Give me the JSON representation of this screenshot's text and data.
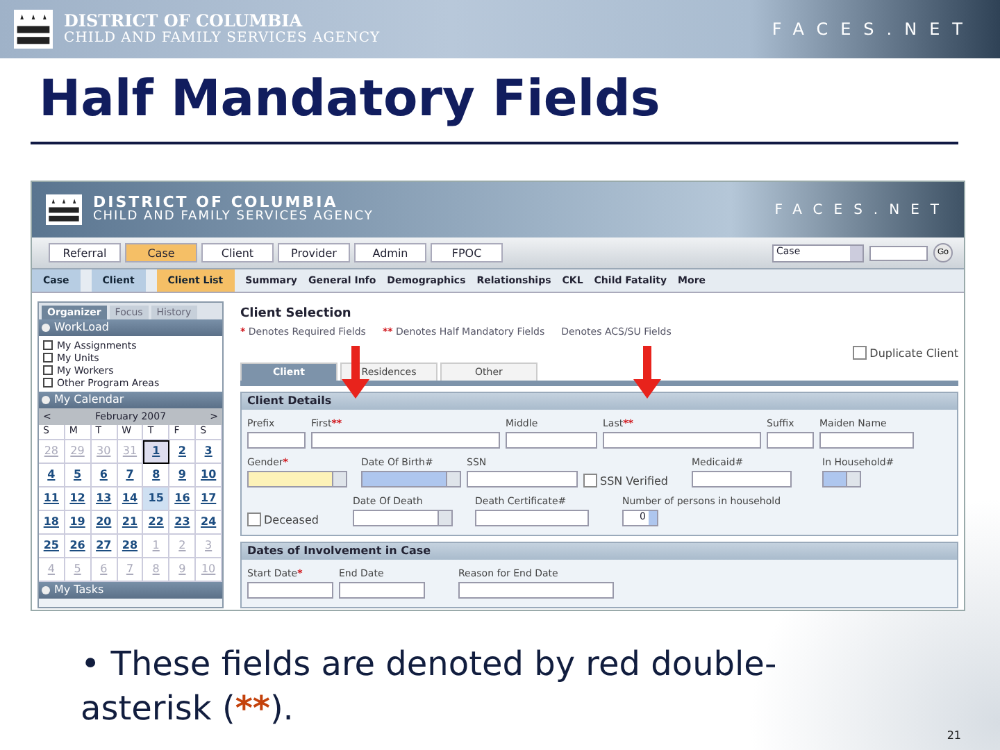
{
  "slide_header": {
    "agency_line_1": "DISTRICT OF COLUMBIA",
    "agency_line_2": "CHILD AND FAMILY SERVICES AGENCY",
    "brand": "FACES.NET"
  },
  "title": "Half Mandatory Fields",
  "screenshot": {
    "header": {
      "agency_line_1": "DISTRICT OF COLUMBIA",
      "agency_line_2": "CHILD AND FAMILY SERVICES AGENCY",
      "brand": "FACES.NET"
    },
    "nav_tabs": [
      {
        "label": "Referral",
        "selected": false
      },
      {
        "label": "Case",
        "selected": true
      },
      {
        "label": "Client",
        "selected": false
      },
      {
        "label": "Provider",
        "selected": false
      },
      {
        "label": "Admin",
        "selected": false
      },
      {
        "label": "FPOC",
        "selected": false
      }
    ],
    "search": {
      "select_value": "Case",
      "button": "Go"
    },
    "breadcrumb": [
      {
        "label": "Case",
        "selected": false
      },
      {
        "label": "Client",
        "selected": false
      },
      {
        "label": "Client List",
        "selected": true
      }
    ],
    "sub_links": [
      "Summary",
      "General Info",
      "Demographics",
      "Relationships",
      "CKL",
      "Child Fatality",
      "More"
    ],
    "sidebar": {
      "tabs": [
        {
          "label": "Organizer",
          "selected": true
        },
        {
          "label": "Focus",
          "selected": false
        },
        {
          "label": "History",
          "selected": false
        }
      ],
      "workload": {
        "title": "WorkLoad",
        "items": [
          "My Assignments",
          "My Units",
          "My Workers",
          "Other Program Areas"
        ]
      },
      "calendar": {
        "title": "My Calendar",
        "prev": "<",
        "month": "February 2007",
        "next": ">",
        "weekdays": [
          "S",
          "M",
          "T",
          "W",
          "T",
          "F",
          "S"
        ],
        "days": [
          {
            "label": "28",
            "other_month": true,
            "selected": false,
            "today": false
          },
          {
            "label": "29",
            "other_month": true,
            "selected": false,
            "today": false
          },
          {
            "label": "30",
            "other_month": true,
            "selected": false,
            "today": false
          },
          {
            "label": "31",
            "other_month": true,
            "selected": false,
            "today": false
          },
          {
            "label": "1",
            "other_month": false,
            "selected": true,
            "today": false
          },
          {
            "label": "2",
            "other_month": false,
            "selected": false,
            "today": false
          },
          {
            "label": "3",
            "other_month": false,
            "selected": false,
            "today": false
          },
          {
            "label": "4",
            "other_month": false,
            "selected": false,
            "today": false
          },
          {
            "label": "5",
            "other_month": false,
            "selected": false,
            "today": false
          },
          {
            "label": "6",
            "other_month": false,
            "selected": false,
            "today": false
          },
          {
            "label": "7",
            "other_month": false,
            "selected": false,
            "today": false
          },
          {
            "label": "8",
            "other_month": false,
            "selected": false,
            "today": false
          },
          {
            "label": "9",
            "other_month": false,
            "selected": false,
            "today": false
          },
          {
            "label": "10",
            "other_month": false,
            "selected": false,
            "today": false
          },
          {
            "label": "11",
            "other_month": false,
            "selected": false,
            "today": false
          },
          {
            "label": "12",
            "other_month": false,
            "selected": false,
            "today": false
          },
          {
            "label": "13",
            "other_month": false,
            "selected": false,
            "today": false
          },
          {
            "label": "14",
            "other_month": false,
            "selected": false,
            "today": false
          },
          {
            "label": "15",
            "other_month": false,
            "selected": false,
            "today": true
          },
          {
            "label": "16",
            "other_month": false,
            "selected": false,
            "today": false
          },
          {
            "label": "17",
            "other_month": false,
            "selected": false,
            "today": false
          },
          {
            "label": "18",
            "other_month": false,
            "selected": false,
            "today": false
          },
          {
            "label": "19",
            "other_month": false,
            "selected": false,
            "today": false
          },
          {
            "label": "20",
            "other_month": false,
            "selected": false,
            "today": false
          },
          {
            "label": "21",
            "other_month": false,
            "selected": false,
            "today": false
          },
          {
            "label": "22",
            "other_month": false,
            "selected": false,
            "today": false
          },
          {
            "label": "23",
            "other_month": false,
            "selected": false,
            "today": false
          },
          {
            "label": "24",
            "other_month": false,
            "selected": false,
            "today": false
          },
          {
            "label": "25",
            "other_month": false,
            "selected": false,
            "today": false
          },
          {
            "label": "26",
            "other_month": false,
            "selected": false,
            "today": false
          },
          {
            "label": "27",
            "other_month": false,
            "selected": false,
            "today": false
          },
          {
            "label": "28",
            "other_month": false,
            "selected": false,
            "today": false
          },
          {
            "label": "1",
            "other_month": true,
            "selected": false,
            "today": false
          },
          {
            "label": "2",
            "other_month": true,
            "selected": false,
            "today": false
          },
          {
            "label": "3",
            "other_month": true,
            "selected": false,
            "today": false
          },
          {
            "label": "4",
            "other_month": true,
            "selected": false,
            "today": false
          },
          {
            "label": "5",
            "other_month": true,
            "selected": false,
            "today": false
          },
          {
            "label": "6",
            "other_month": true,
            "selected": false,
            "today": false
          },
          {
            "label": "7",
            "other_month": true,
            "selected": false,
            "today": false
          },
          {
            "label": "8",
            "other_month": true,
            "selected": false,
            "today": false
          },
          {
            "label": "9",
            "other_month": true,
            "selected": false,
            "today": false
          },
          {
            "label": "10",
            "other_month": true,
            "selected": false,
            "today": false
          }
        ]
      },
      "tasks": {
        "title": "My Tasks"
      }
    },
    "main": {
      "title": "Client Selection",
      "legend": [
        {
          "marker": "*",
          "text": "Denotes Required Fields"
        },
        {
          "marker": "**",
          "text": "Denotes Half Mandatory Fields"
        },
        {
          "text": "Denotes ACS/SU Fields"
        }
      ],
      "duplicate": {
        "label": "Duplicate Client",
        "checked": false
      },
      "tabs": [
        {
          "label": "Client",
          "selected": true
        },
        {
          "label": "Residences",
          "selected": false
        },
        {
          "label": "Other",
          "selected": false
        }
      ],
      "sections": [
        {
          "title": "Client Details",
          "rows": [
            [
              {
                "kind": "text",
                "label": "Prefix"
              },
              {
                "kind": "text",
                "label": "First",
                "marker": "**",
                "arrow": true
              },
              {
                "kind": "text",
                "label": "Middle"
              },
              {
                "kind": "text",
                "label": "Last",
                "marker": "**",
                "arrow": true
              },
              {
                "kind": "text",
                "label": "Suffix"
              },
              {
                "kind": "text",
                "label": "Maiden Name"
              }
            ],
            [
              {
                "kind": "select",
                "label": "Gender",
                "marker": "*",
                "color": "#fdf2b8"
              },
              {
                "kind": "select",
                "label": "Date Of Birth#",
                "color": "#aec6ee"
              },
              {
                "kind": "text",
                "label": "SSN"
              },
              {
                "kind": "checkbox",
                "label": "SSN Verified",
                "checked": false
              },
              {
                "kind": "text",
                "label": "Medicaid#"
              },
              {
                "kind": "select",
                "label": "In Household#",
                "color": "#aec6ee"
              }
            ],
            [
              {
                "kind": "checkbox",
                "label": "Deceased",
                "checked": false
              },
              {
                "kind": "select",
                "label": "Date Of Death",
                "color": "#ffffff"
              },
              {
                "kind": "text",
                "label": "Death Certificate#"
              },
              {
                "kind": "spinner",
                "label": "Number of persons in household",
                "value": "0"
              }
            ]
          ]
        },
        {
          "title": "Dates of Involvement in Case",
          "rows": [
            [
              {
                "kind": "text",
                "label": "Start Date",
                "marker": "*"
              },
              {
                "kind": "text",
                "label": "End Date"
              },
              {
                "kind": "text",
                "label": "Reason for End Date"
              }
            ]
          ]
        }
      ]
    }
  },
  "bullet": {
    "before": "• These fields are denoted by red double-asterisk (",
    "mark": "**",
    "after": ")."
  },
  "page_number": "21"
}
